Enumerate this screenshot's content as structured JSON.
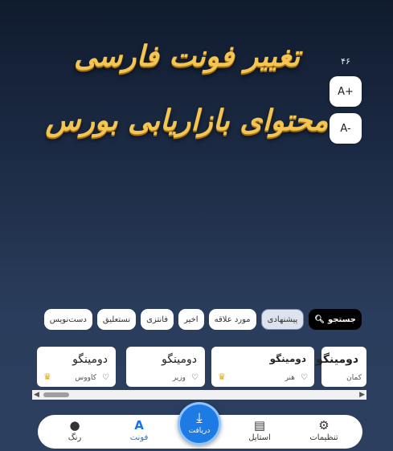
{
  "preview": {
    "text": "تغییر فونت فارسی محتوای بازاریابی بورس"
  },
  "font_size": {
    "value": "۴۶",
    "increase_label": "A+",
    "decrease_label": "A-"
  },
  "categories": {
    "search_label": "جستجو",
    "items": [
      "پیشنهادی",
      "مورد علاقه",
      "اخیر",
      "فانتزی",
      "نستعلیق",
      "دست‌نویس"
    ],
    "active": "پیشنهادی"
  },
  "font_cards": [
    {
      "name": "دومینگو",
      "sub": "کمان",
      "heart": false,
      "crown": false
    },
    {
      "name": "دومینگو",
      "sub": "هنر",
      "heart": true,
      "crown": true
    },
    {
      "name": "دومینگو",
      "sub": "وزیر",
      "heart": true,
      "crown": false
    },
    {
      "name": "دومینگو",
      "sub": "کاووس",
      "heart": true,
      "crown": true
    }
  ],
  "nav": {
    "settings": "تنظیمات",
    "style": "استایل",
    "download": "دریافت",
    "font": "فونت",
    "color": "رنگ",
    "active": "font"
  }
}
